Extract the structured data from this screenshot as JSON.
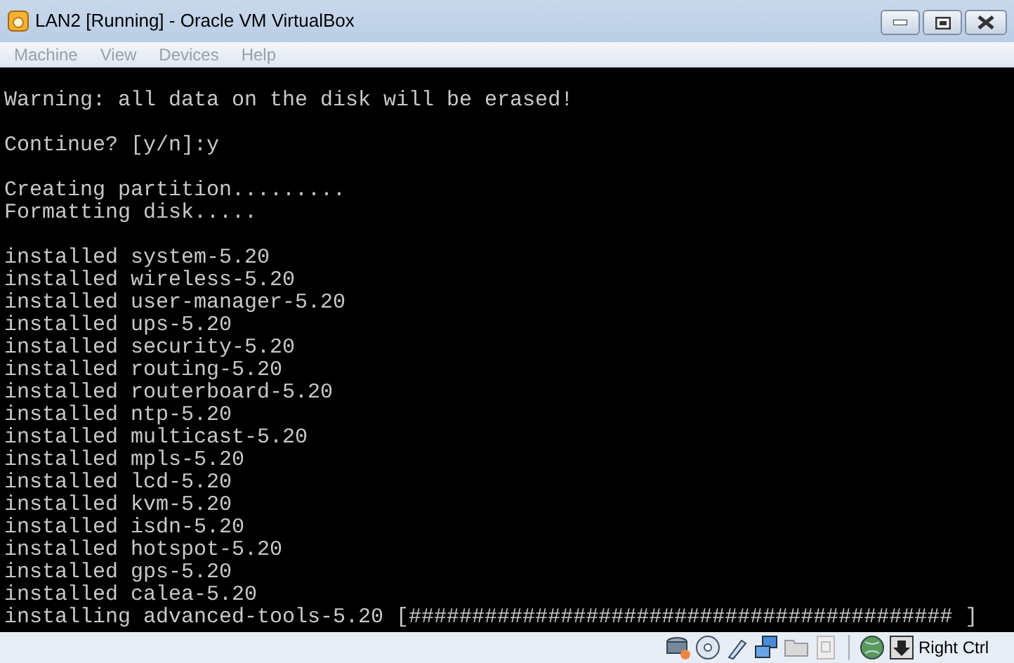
{
  "window": {
    "title": "LAN2 [Running] - Oracle VM VirtualBox"
  },
  "menu": [
    {
      "label": "Machine",
      "disabled": true
    },
    {
      "label": "View",
      "disabled": true
    },
    {
      "label": "Devices",
      "disabled": true
    },
    {
      "label": "Help",
      "disabled": true
    }
  ],
  "console": {
    "blocks": [
      [
        "Warning: all data on the disk will be erased!"
      ],
      [
        "Continue? [y/n]:y"
      ],
      [
        "Creating partition.........",
        "Formatting disk....."
      ],
      [
        "installed system-5.20",
        "installed wireless-5.20",
        "installed user-manager-5.20",
        "installed ups-5.20",
        "installed security-5.20",
        "installed routing-5.20",
        "installed routerboard-5.20",
        "installed ntp-5.20",
        "installed multicast-5.20",
        "installed mpls-5.20",
        "installed lcd-5.20",
        "installed kvm-5.20",
        "installed isdn-5.20",
        "installed hotspot-5.20",
        "installed gps-5.20",
        "installed calea-5.20",
        "installing advanced-tools-5.20 [########################################### ]"
      ]
    ]
  },
  "status_bar": {
    "host_key": "Right Ctrl"
  }
}
